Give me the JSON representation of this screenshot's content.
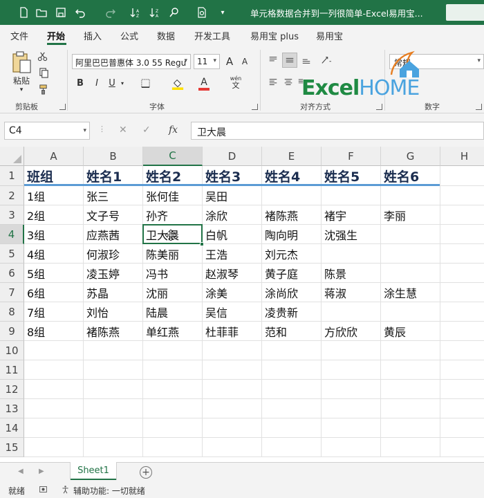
{
  "title": "单元格数据合并到一列很简单-Excel易用宝...",
  "menu_tabs": [
    "文件",
    "开始",
    "插入",
    "公式",
    "数据",
    "开发工具",
    "易用宝 plus",
    "易用宝"
  ],
  "ribbon": {
    "paste_label": "粘贴",
    "clipboard_label": "剪贴板",
    "font_name": "阿里巴巴普惠体 3.0 55 Regu",
    "font_size": "11",
    "font_label": "字体",
    "align_label": "对齐方式",
    "number_label": "数字",
    "number_format": "常规",
    "bold": "B",
    "italic": "I",
    "underline": "U",
    "wen_top": "wén",
    "wen_bot": "文",
    "grow": "A",
    "shrink": "A",
    "font_color_a": "A"
  },
  "logo": {
    "excel": "Excel",
    "home": "HOME"
  },
  "colors": {
    "accent": "#217346",
    "header_line": "#5b9bd5",
    "fill_yellow": "#ffe100",
    "font_red": "#e53935"
  },
  "formula": {
    "namebox": "C4",
    "fx": "fx",
    "content": "卫大晨"
  },
  "grid": {
    "columns": [
      "A",
      "B",
      "C",
      "D",
      "E",
      "F",
      "G",
      "H"
    ],
    "rows": [
      "1",
      "2",
      "3",
      "4",
      "5",
      "6",
      "7",
      "8",
      "9",
      "10",
      "11",
      "12",
      "13",
      "14",
      "15"
    ],
    "header_row": [
      "班组",
      "姓名1",
      "姓名2",
      "姓名3",
      "姓名4",
      "姓名5",
      "姓名6"
    ],
    "data": [
      [
        "1组",
        "张三",
        "张何佳",
        "吴田",
        "",
        "",
        ""
      ],
      [
        "2组",
        "文子号",
        "孙齐",
        "涂欣",
        "褚陈燕",
        "褚宇",
        "李丽"
      ],
      [
        "3组",
        "应燕茜",
        "卫大晨",
        "白帆",
        "陶向明",
        "沈强生",
        ""
      ],
      [
        "4组",
        "何淑珍",
        "陈美丽",
        "王浩",
        "刘元杰",
        "",
        ""
      ],
      [
        "5组",
        "凌玉婷",
        "冯书",
        "赵淑琴",
        "黄子庭",
        "陈景",
        ""
      ],
      [
        "6组",
        "苏晶",
        "沈丽",
        "涂美",
        "涂尚欣",
        "蒋淑",
        "涂生慧"
      ],
      [
        "7组",
        "刘怡",
        "陆晨",
        "吴信",
        "凌贵新",
        "",
        ""
      ],
      [
        "8组",
        "褚陈燕",
        "单红燕",
        "杜菲菲",
        "范和",
        "方欣欣",
        "黄辰"
      ]
    ]
  },
  "sheet": {
    "tab": "Sheet1",
    "add": "+"
  },
  "status": {
    "ready": "就绪",
    "accessibility": "辅助功能: 一切就绪"
  }
}
